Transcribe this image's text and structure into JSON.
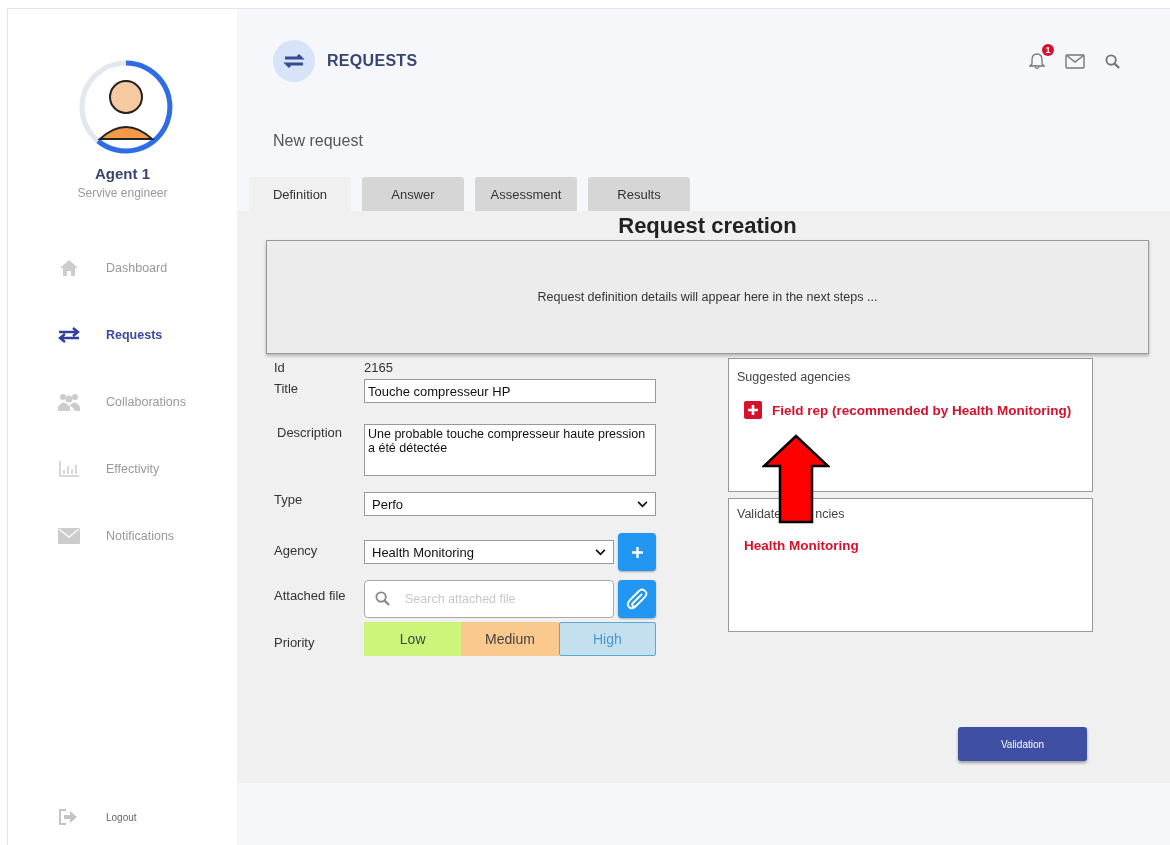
{
  "sidebar": {
    "user": {
      "name": "Agent 1",
      "role": "Servive engineer"
    },
    "items": [
      {
        "label": "Dashboard",
        "kind": "home",
        "selected": false
      },
      {
        "label": "Requests",
        "kind": "arrows",
        "selected": true
      },
      {
        "label": "Collaborations",
        "kind": "people",
        "selected": false
      },
      {
        "label": "Effectivity",
        "kind": "chart",
        "selected": false
      },
      {
        "label": "Notifications",
        "kind": "mail",
        "selected": false
      }
    ],
    "logout": "Logout"
  },
  "header": {
    "title": "REQUESTS",
    "notification_count": "1"
  },
  "subtitle": "New request",
  "tabs": [
    {
      "label": "Definition",
      "selected": true
    },
    {
      "label": "Answer",
      "selected": false
    },
    {
      "label": "Assessment",
      "selected": false
    },
    {
      "label": "Results",
      "selected": false
    }
  ],
  "panel": {
    "heading": "Request creation",
    "details_note": "Request definition details will appear here in the next steps ..."
  },
  "form": {
    "id": {
      "label": "Id",
      "value": "2165"
    },
    "title": {
      "label": "Title",
      "value": "Touche compresseur HP"
    },
    "description": {
      "label": "Description",
      "value": "Une probable touche compresseur haute pression a été détectée"
    },
    "type": {
      "label": "Type",
      "value": "Perfo"
    },
    "agency": {
      "label": "Agency",
      "value": "Health Monitoring"
    },
    "attached_file": {
      "label": "Attached file",
      "placeholder": "Search attached file"
    },
    "priority": {
      "label": "Priority",
      "options": [
        {
          "label": "Low",
          "color": "#ccf57a",
          "selected": false
        },
        {
          "label": "Medium",
          "color": "#f9c98e",
          "selected": false
        },
        {
          "label": "High",
          "color": "#c4dfee",
          "selected": true
        }
      ]
    }
  },
  "suggested_agencies": {
    "label": "Suggested agencies",
    "items": [
      "Field rep (recommended by Health Monitoring)"
    ]
  },
  "validated_agencies": {
    "label_parts": [
      "Validate",
      "ncies"
    ],
    "items": [
      "Health Monitoring"
    ]
  },
  "validation_button": "Validation"
}
